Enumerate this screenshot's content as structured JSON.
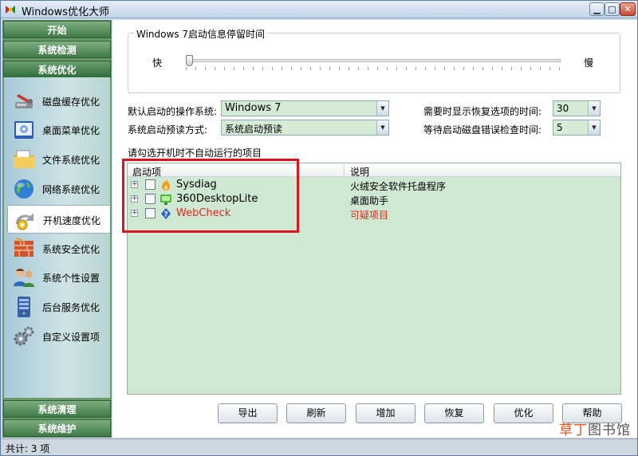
{
  "window": {
    "title": "Windows优化大师",
    "min_glyph": "▁",
    "max_glyph": "□",
    "close_glyph": "✕"
  },
  "sidebar": {
    "categories_top": [
      "开始",
      "系统检测",
      "系统优化"
    ],
    "categories_bottom": [
      "系统清理",
      "系统维护"
    ],
    "items": [
      {
        "label": "磁盘缓存优化",
        "icon": "disk-cache-icon"
      },
      {
        "label": "桌面菜单优化",
        "icon": "desktop-menu-icon"
      },
      {
        "label": "文件系统优化",
        "icon": "file-system-icon"
      },
      {
        "label": "网络系统优化",
        "icon": "network-globe-icon"
      },
      {
        "label": "开机速度优化",
        "icon": "boot-speed-icon"
      },
      {
        "label": "系统安全优化",
        "icon": "security-wall-icon"
      },
      {
        "label": "系统个性设置",
        "icon": "users-icon"
      },
      {
        "label": "后台服务优化",
        "icon": "server-icon"
      },
      {
        "label": "自定义设置项",
        "icon": "gears-icon"
      }
    ],
    "selected_index": 4
  },
  "startup_delay": {
    "title": "Windows 7启动信息停留时间",
    "fast_label": "快",
    "slow_label": "慢",
    "level": 0.0
  },
  "settings": {
    "default_os_label": "默认启动的操作系统:",
    "default_os_value": "Windows 7",
    "prefetch_label": "系统启动预读方式:",
    "prefetch_value": "系统启动预读",
    "restore_time_label": "需要时显示恢复选项的时间:",
    "restore_time_value": "30",
    "disk_check_label": "等待启动磁盘错误检查时间:",
    "disk_check_value": "5"
  },
  "startup_list": {
    "caption": "请勾选开机时不自动运行的项目",
    "columns": [
      "启动项",
      "说明"
    ],
    "rows": [
      {
        "name": "Sysdiag",
        "desc": "火绒安全软件托盘程序",
        "icon": "flame-icon",
        "suspicious": false
      },
      {
        "name": "360DesktopLite",
        "desc": "桌面助手",
        "icon": "monitor-icon",
        "suspicious": false
      },
      {
        "name": "WebCheck",
        "desc": "可疑项目",
        "icon": "question-shield-icon",
        "suspicious": true
      }
    ]
  },
  "buttons": [
    "导出",
    "刷新",
    "增加",
    "恢复",
    "优化",
    "帮助"
  ],
  "status": {
    "text": "共计: 3 项"
  },
  "watermark": {
    "accent": "草丁",
    "rest": "图书馆"
  },
  "colors": {
    "list_bg": "#cfe8d2",
    "suspicious": "#e0261b",
    "highlight": "#e0121b"
  }
}
